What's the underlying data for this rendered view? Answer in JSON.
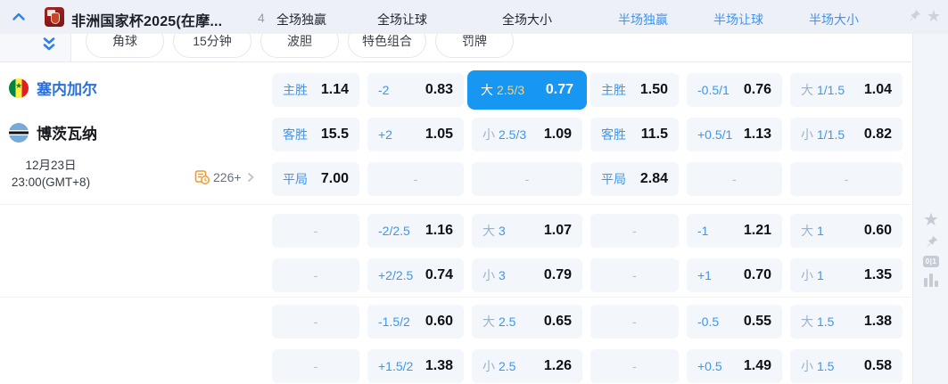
{
  "header": {
    "title": "非洲国家杯2025(在摩...",
    "count": "4",
    "tabs": [
      {
        "label": "全场独赢",
        "active": false
      },
      {
        "label": "全场让球",
        "active": false
      },
      {
        "label": "全场大小",
        "active": false
      },
      {
        "label": "半场独赢",
        "active": true
      },
      {
        "label": "半场让球",
        "active": true
      },
      {
        "label": "半场大小",
        "active": true
      }
    ]
  },
  "filters": {
    "pills": [
      "角球",
      "15分钟",
      "波胆",
      "特色组合",
      "罚牌"
    ]
  },
  "match": {
    "home_team": "塞内加尔",
    "away_team": "博茨瓦纳",
    "date": "12月23日",
    "time": "23:00(GMT+8)",
    "more_markets_count": "226+"
  },
  "colors": {
    "accent_blue": "#3d97f0",
    "selected_cell_bg": "#1797f2",
    "selected_line_gold": "#f6d37c",
    "team_home_blue": "#2b6fd9",
    "more_icon_orange": "#f09a2d"
  },
  "sidebar": {
    "zero_one_badge": "0|1",
    "star": "★"
  },
  "odds_sections": [
    {
      "rows": [
        [
          {
            "label": "主胜",
            "value": "1.14"
          },
          {
            "label": "-2",
            "value": "0.83"
          },
          {
            "ou": "大",
            "line": "2.5/3",
            "value": "0.77",
            "selected": true
          },
          {
            "label": "主胜",
            "value": "1.50"
          },
          {
            "label": "-0.5/1",
            "value": "0.76"
          },
          {
            "ou": "大",
            "line": "1/1.5",
            "value": "1.04"
          }
        ],
        [
          {
            "label": "客胜",
            "value": "15.5"
          },
          {
            "label": "+2",
            "value": "1.05"
          },
          {
            "ou": "小",
            "line": "2.5/3",
            "value": "1.09"
          },
          {
            "label": "客胜",
            "value": "11.5"
          },
          {
            "label": "+0.5/1",
            "value": "1.13"
          },
          {
            "ou": "小",
            "line": "1/1.5",
            "value": "0.82"
          }
        ],
        [
          {
            "label": "平局",
            "value": "7.00"
          },
          {
            "dash": true
          },
          {
            "dash": true
          },
          {
            "label": "平局",
            "value": "2.84"
          },
          {
            "dash": true
          },
          {
            "dash": true
          }
        ]
      ]
    },
    {
      "rows": [
        [
          {
            "dash": true
          },
          {
            "label": "-2/2.5",
            "value": "1.16"
          },
          {
            "ou": "大",
            "line": "3",
            "value": "1.07"
          },
          {
            "dash": true
          },
          {
            "label": "-1",
            "value": "1.21"
          },
          {
            "ou": "大",
            "line": "1",
            "value": "0.60"
          }
        ],
        [
          {
            "dash": true
          },
          {
            "label": "+2/2.5",
            "value": "0.74"
          },
          {
            "ou": "小",
            "line": "3",
            "value": "0.79"
          },
          {
            "dash": true
          },
          {
            "label": "+1",
            "value": "0.70"
          },
          {
            "ou": "小",
            "line": "1",
            "value": "1.35"
          }
        ]
      ]
    },
    {
      "rows": [
        [
          {
            "dash": true
          },
          {
            "label": "-1.5/2",
            "value": "0.60"
          },
          {
            "ou": "大",
            "line": "2.5",
            "value": "0.65"
          },
          {
            "dash": true
          },
          {
            "label": "-0.5",
            "value": "0.55"
          },
          {
            "ou": "大",
            "line": "1.5",
            "value": "1.38"
          }
        ],
        [
          {
            "dash": true
          },
          {
            "label": "+1.5/2",
            "value": "1.38"
          },
          {
            "ou": "小",
            "line": "2.5",
            "value": "1.26"
          },
          {
            "dash": true
          },
          {
            "label": "+0.5",
            "value": "1.49"
          },
          {
            "ou": "小",
            "line": "1.5",
            "value": "0.58"
          }
        ]
      ]
    }
  ]
}
